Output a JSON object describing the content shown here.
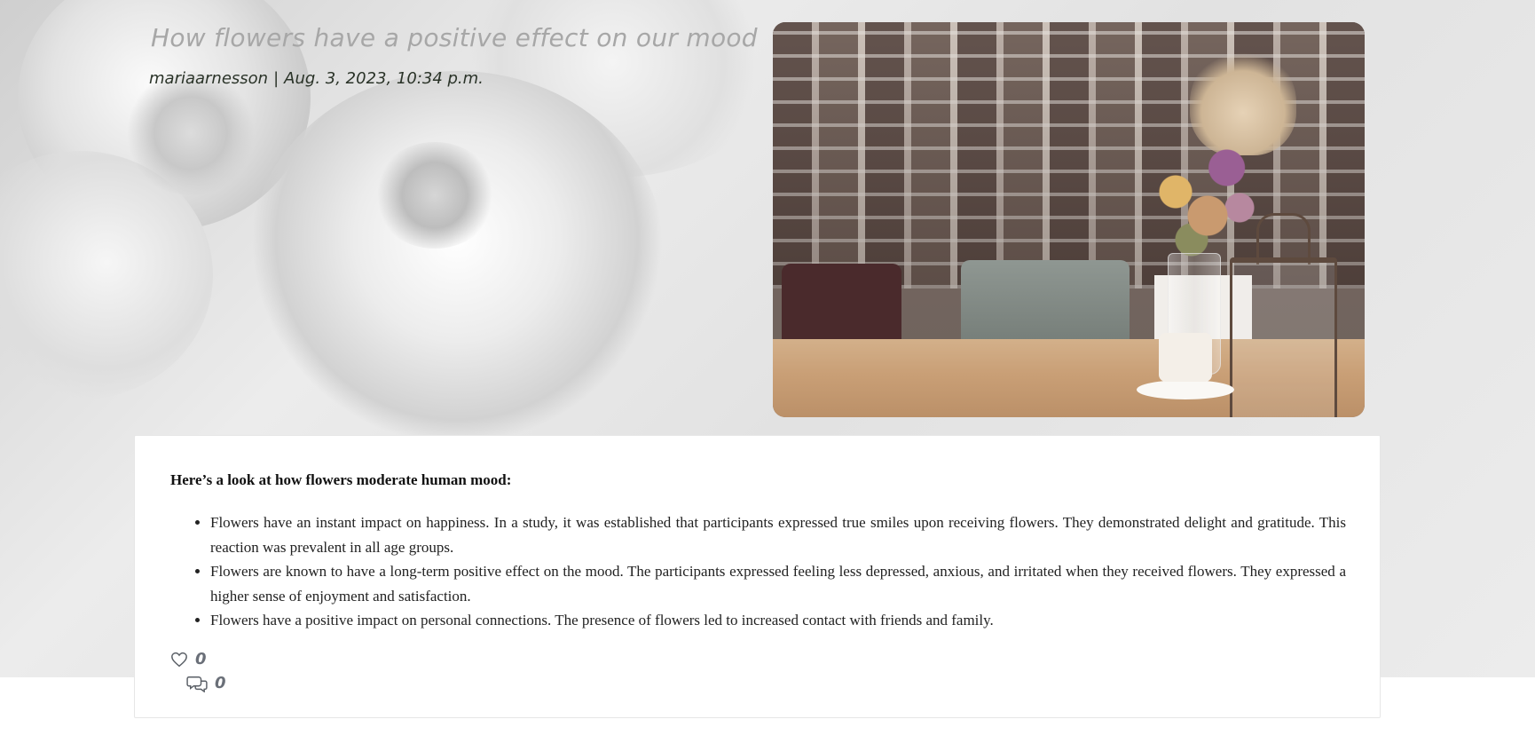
{
  "post": {
    "title": "How flowers have a positive effect on our mood",
    "author": "mariaarnesson",
    "separator": "|",
    "date": "Aug. 3, 2023, 10:34 p.m."
  },
  "content": {
    "lead": "Here’s a look at how flowers moderate human mood:",
    "bullets": [
      "Flowers have an instant impact on happiness. In a study, it was established that participants expressed true smiles upon receiving flowers. They demonstrated delight and gratitude. This reaction was prevalent in all age groups.",
      "Flowers are known to have a long-term positive effect on the mood. The participants expressed feeling less depressed, anxious, and irritated when they received flowers. They expressed a higher sense of enjoyment and satisfaction.",
      "Flowers have a positive impact on personal connections. The presence of flowers led to increased contact with friends and family."
    ]
  },
  "stats": {
    "likes": "0",
    "comments": "0"
  },
  "icons": {
    "like": "heart-icon",
    "comment": "comments-icon"
  }
}
